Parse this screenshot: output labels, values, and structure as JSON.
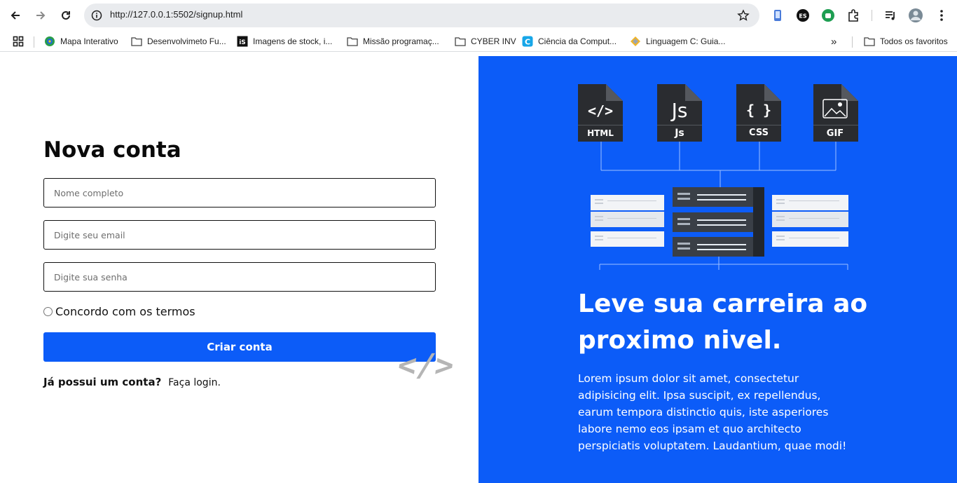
{
  "browser": {
    "url": "http://127.0.0.1:5502/signup.html",
    "bookmarks": [
      {
        "label": "Mapa Interativo",
        "icon": "map-favicon"
      },
      {
        "label": "Desenvolvimeto Fu...",
        "icon": "folder-icon"
      },
      {
        "label": "Imagens de stock, i...",
        "icon": "istock-favicon"
      },
      {
        "label": "Missão programaç...",
        "icon": "folder-icon"
      },
      {
        "label": "CYBER INV",
        "icon": "folder-icon"
      },
      {
        "label": "Ciência da Comput...",
        "icon": "c-favicon"
      },
      {
        "label": "Linguagem C: Guia...",
        "icon": "diamond-favicon"
      }
    ],
    "all_bookmarks": "Todos os favoritos",
    "overflow_glyph": "»"
  },
  "signup": {
    "title": "Nova conta",
    "name_placeholder": "Nome completo",
    "email_placeholder": "Digite seu email",
    "password_placeholder": "Digite sua senha",
    "terms_label": "Concordo com os termos",
    "submit_label": "Criar conta",
    "login_question": "Já possui um conta?",
    "login_link": "Faça login.",
    "code_decoration": "</>"
  },
  "hero": {
    "title": "Leve sua carreira ao proximo nivel.",
    "text": "Lorem ipsum dolor sit amet, consectetur adipisicing elit. Ipsa suscipit, ex repellendus, earum tempora distinctio quis, iste asperiores labore nemo eos ipsam et quo architecto perspiciatis voluptatem. Laudantium, quae modi!",
    "files": [
      {
        "glyph": "</>",
        "label": "HTML"
      },
      {
        "glyph": "Js",
        "label": "Js"
      },
      {
        "glyph": "{ }",
        "label": "CSS"
      },
      {
        "glyph": "",
        "label": "GIF"
      }
    ]
  },
  "colors": {
    "accent": "#0c5cf8",
    "file_dark": "#2a2c30"
  }
}
